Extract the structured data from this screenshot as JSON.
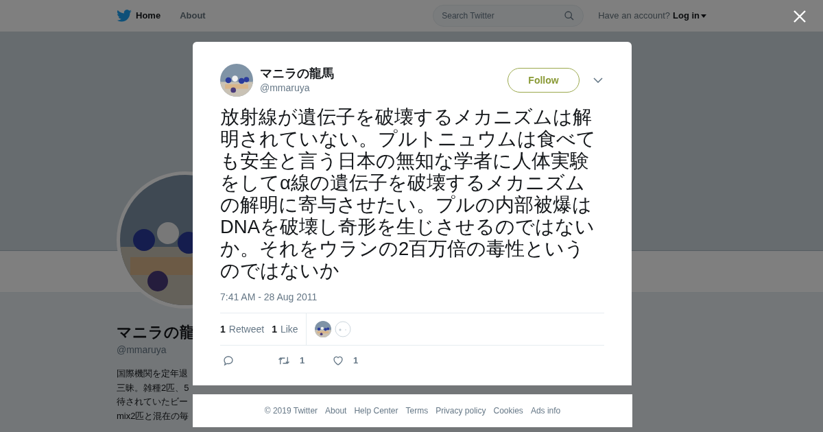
{
  "header": {
    "nav": [
      {
        "label": "Home",
        "selected": true
      },
      {
        "label": "About",
        "selected": false
      }
    ],
    "search": {
      "placeholder": "Search Twitter"
    },
    "account_prompt": "Have an account?",
    "login": "Log in"
  },
  "profile": {
    "name": "マニラの龍",
    "handle": "@mmaruya",
    "bio_lines": [
      "国際機関を定年退",
      "三昧。雑種2匹、5",
      "待されていたビー",
      "mix2匹と混在の毎"
    ]
  },
  "tweet": {
    "author": "マニラの龍馬",
    "handle": "@mmaruya",
    "follow": "Follow",
    "text": "放射線が遺伝子を破壊するメカニズムは解明されていない。プルトニュウムは食べても安全と言う日本の無知な学者に人体実験をしてα線の遺伝子を破壊するメカニズムの解明に寄与させたい。プルの内部被爆はDNAを破壊し奇形を生じさせるのではないか。それをウランの2百万倍の毒性というのではないか",
    "timestamp": "7:41 AM - 28 Aug 2011",
    "stats": [
      {
        "count": "1",
        "label": "Retweet"
      },
      {
        "count": "1",
        "label": "Like"
      }
    ],
    "actions": [
      {
        "kind": "reply"
      },
      {
        "kind": "retweet",
        "count": "1"
      },
      {
        "kind": "like",
        "count": "1"
      }
    ]
  },
  "footer": [
    "© 2019 Twitter",
    "About",
    "Help Center",
    "Terms",
    "Privacy policy",
    "Cookies",
    "Ads info"
  ]
}
